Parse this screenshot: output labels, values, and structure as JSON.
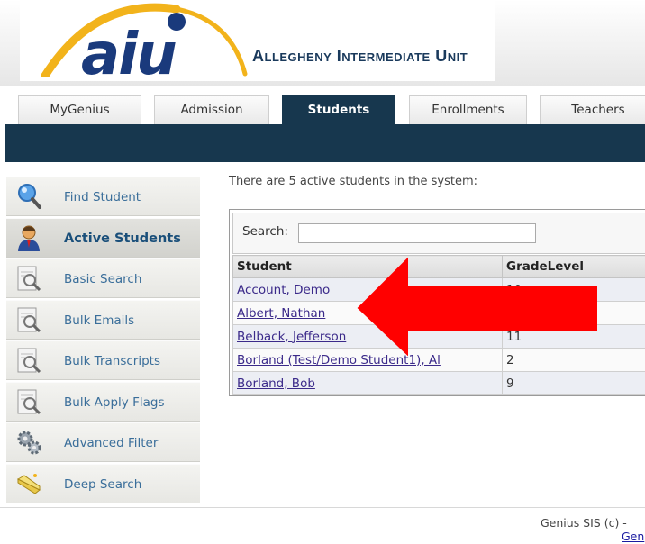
{
  "header": {
    "logo_text": "aiu",
    "org_name": "Allegheny Intermediate Unit",
    "colors": {
      "navy": "#17374e",
      "logo_blue": "#1a3a7c",
      "logo_gold": "#f2b31b"
    }
  },
  "tabs": [
    {
      "label": "MyGenius",
      "active": false
    },
    {
      "label": "Admission",
      "active": false
    },
    {
      "label": "Students",
      "active": true
    },
    {
      "label": "Enrollments",
      "active": false
    },
    {
      "label": "Teachers",
      "active": false
    }
  ],
  "sidebar": {
    "items": [
      {
        "label": "Find Student",
        "icon": "magnifier-icon",
        "active": false
      },
      {
        "label": "Active Students",
        "icon": "person-icon",
        "active": true
      },
      {
        "label": "Basic Search",
        "icon": "document-search-icon",
        "active": false
      },
      {
        "label": "Bulk Emails",
        "icon": "document-search-icon",
        "active": false
      },
      {
        "label": "Bulk Transcripts",
        "icon": "document-search-icon",
        "active": false
      },
      {
        "label": "Bulk Apply Flags",
        "icon": "document-search-icon",
        "active": false
      },
      {
        "label": "Advanced Filter",
        "icon": "gears-icon",
        "active": false
      },
      {
        "label": "Deep Search",
        "icon": "wand-icon",
        "active": false
      }
    ]
  },
  "main": {
    "intro": "There are 5 active students in the system:",
    "search": {
      "label": "Search:",
      "value": ""
    },
    "columns": [
      "Student",
      "GradeLevel"
    ],
    "rows": [
      {
        "student": "Account, Demo",
        "grade": "10"
      },
      {
        "student": "Albert, Nathan",
        "grade": ""
      },
      {
        "student": "Belback, Jefferson",
        "grade": "11"
      },
      {
        "student": "Borland (Test/Demo Student1), Al",
        "grade": "2"
      },
      {
        "student": "Borland, Bob",
        "grade": "9"
      }
    ]
  },
  "overlay": {
    "arrow_color": "#ff0000",
    "direction": "left"
  },
  "footer": {
    "copyright": "Genius SIS (c) -",
    "link": "Gen"
  }
}
